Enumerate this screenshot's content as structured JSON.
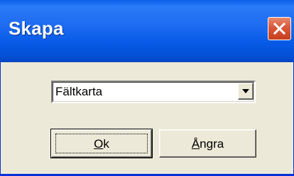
{
  "window": {
    "title": "Skapa",
    "close_icon": "close-icon"
  },
  "combo": {
    "value": "Fältkarta",
    "arrow_icon": "chevron-down-icon"
  },
  "buttons": {
    "ok": {
      "accel": "O",
      "rest": "k"
    },
    "cancel": {
      "accel": "Å",
      "rest": "ngra"
    }
  },
  "colors": {
    "titlebar": "#0a5ee9",
    "close": "#d9573a",
    "face": "#ece9d8"
  }
}
